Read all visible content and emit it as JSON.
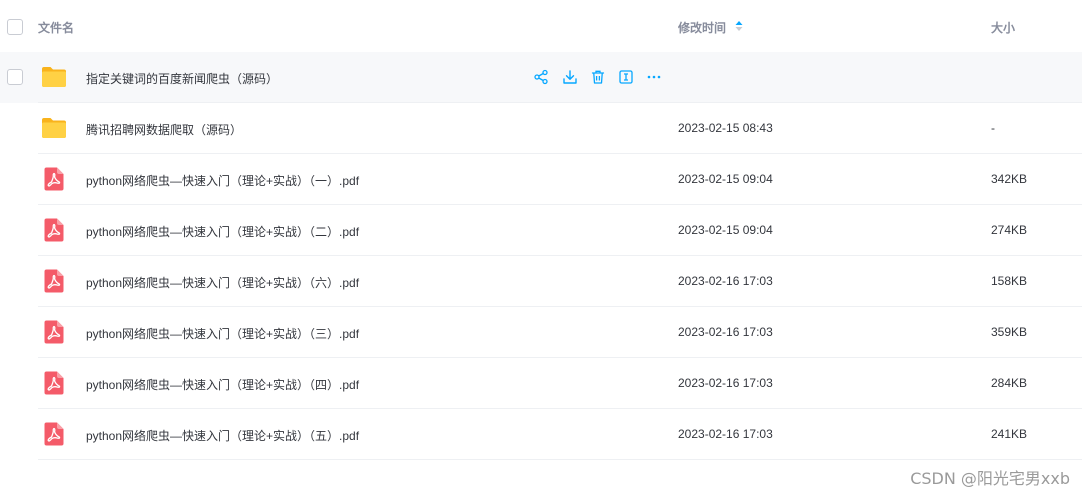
{
  "header": {
    "name_label": "文件名",
    "time_label": "修改时间",
    "size_label": "大小"
  },
  "files": [
    {
      "name": "指定关键词的百度新闻爬虫（源码）",
      "time": "",
      "size": "",
      "type": "folder",
      "hovered": true
    },
    {
      "name": "腾讯招聘网数据爬取（源码）",
      "time": "2023-02-15 08:43",
      "size": "-",
      "type": "folder"
    },
    {
      "name": "python网络爬虫—快速入门（理论+实战）（一）.pdf",
      "time": "2023-02-15 09:04",
      "size": "342KB",
      "type": "pdf"
    },
    {
      "name": "python网络爬虫—快速入门（理论+实战）（二）.pdf",
      "time": "2023-02-15 09:04",
      "size": "274KB",
      "type": "pdf"
    },
    {
      "name": "python网络爬虫—快速入门（理论+实战）（六）.pdf",
      "time": "2023-02-16 17:03",
      "size": "158KB",
      "type": "pdf"
    },
    {
      "name": "python网络爬虫—快速入门（理论+实战）（三）.pdf",
      "time": "2023-02-16 17:03",
      "size": "359KB",
      "type": "pdf"
    },
    {
      "name": "python网络爬虫—快速入门（理论+实战）（四）.pdf",
      "time": "2023-02-16 17:03",
      "size": "284KB",
      "type": "pdf"
    },
    {
      "name": "python网络爬虫—快速入门（理论+实战）（五）.pdf",
      "time": "2023-02-16 17:03",
      "size": "241KB",
      "type": "pdf"
    }
  ],
  "row_actions": [
    "share-icon",
    "download-icon",
    "delete-icon",
    "rename-icon",
    "more-icon"
  ],
  "watermark": "CSDN @阳光宅男xxb",
  "colors": {
    "accent": "#06a7ff",
    "folder": "#ffc933",
    "pdf": "#f45b69",
    "hover_bg": "#f7f8fa"
  }
}
